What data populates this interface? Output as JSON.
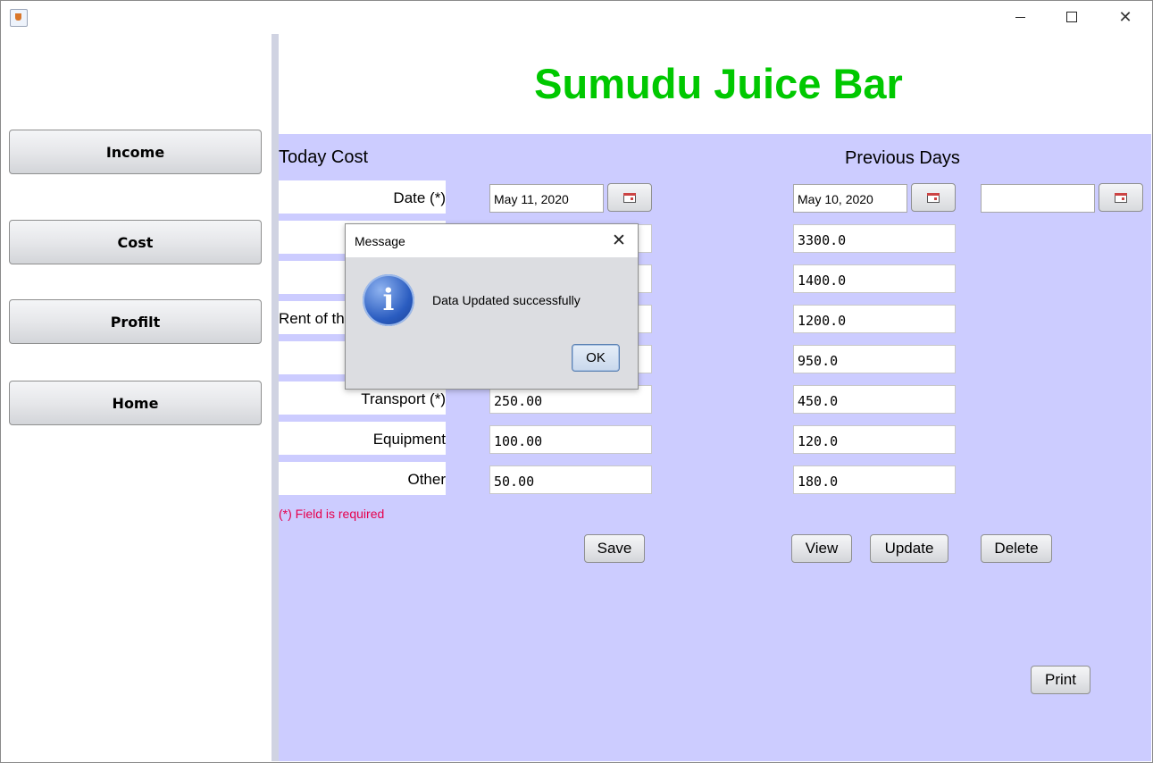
{
  "window": {
    "minimize_icon": "minimize-icon",
    "maximize_icon": "maximize-icon",
    "close_icon": "close-icon"
  },
  "sidebar": {
    "items": [
      {
        "label": "Income"
      },
      {
        "label": "Cost"
      },
      {
        "label": "Profilt"
      },
      {
        "label": "Home"
      }
    ]
  },
  "header": {
    "title": "Sumudu Juice Bar",
    "title_color": "#00c800"
  },
  "colors": {
    "content_bg": "#ccccff",
    "required_note": "#e6004c"
  },
  "today": {
    "heading": "Today Cost",
    "date_label": "Date (*)",
    "date_value": "May 11, 2020",
    "rows": [
      {
        "label": "",
        "value": ""
      },
      {
        "label": "",
        "value": ""
      },
      {
        "label": "Rent of th",
        "value": ""
      },
      {
        "label": "",
        "value": ""
      },
      {
        "label": "Transport (*)",
        "value": "250.00"
      },
      {
        "label": "Equipment",
        "value": "100.00"
      },
      {
        "label": "Other",
        "value": "50.00"
      }
    ],
    "required_note": "(*) Field is required",
    "save_label": "Save"
  },
  "previous": {
    "heading": "Previous Days",
    "date_value": "May 10, 2020",
    "date2_value": "",
    "values": [
      "3300.0",
      "1400.0",
      "1200.0",
      "950.0",
      "450.0",
      "120.0",
      "180.0"
    ],
    "view_label": "View",
    "update_label": "Update",
    "delete_label": "Delete",
    "print_label": "Print"
  },
  "dialog": {
    "title": "Message",
    "message": "Data Updated successfully",
    "ok_label": "OK",
    "icon": "info-icon"
  }
}
